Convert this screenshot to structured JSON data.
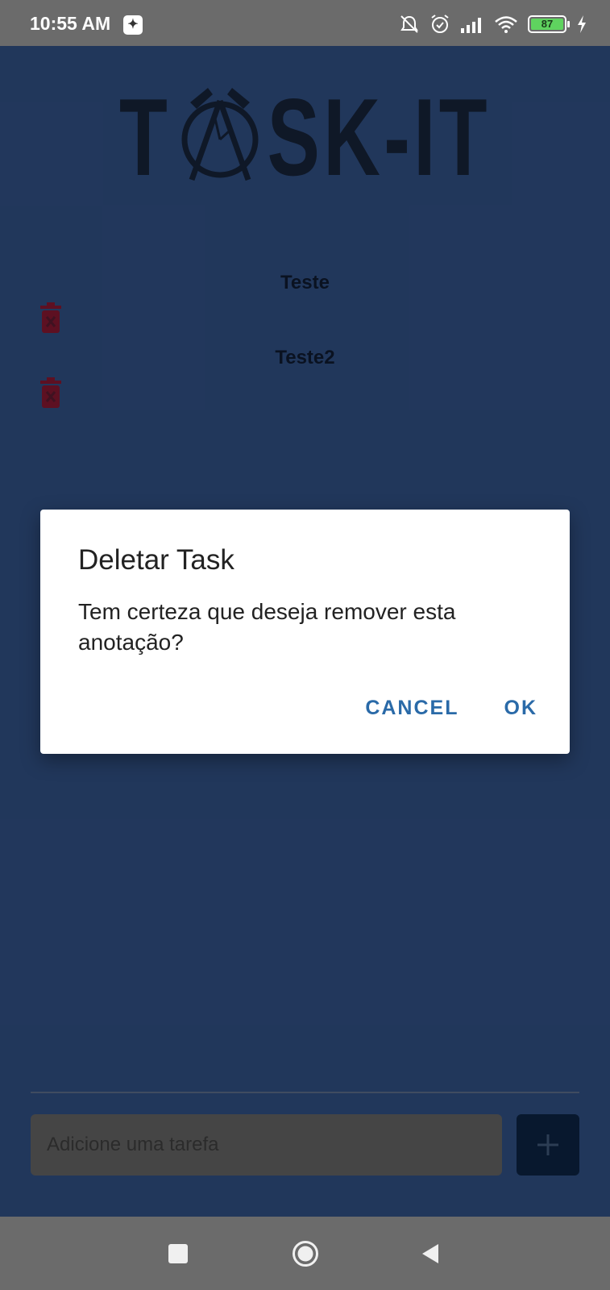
{
  "status_bar": {
    "time": "10:55 AM",
    "battery_level": "87",
    "icons": [
      "notification-app-icon",
      "mute-icon",
      "alarm-icon",
      "signal-icon",
      "wifi-icon",
      "battery-icon",
      "charging-icon"
    ]
  },
  "app": {
    "logo_text": {
      "left": "T",
      "right": "SK-IT"
    },
    "tasks": [
      {
        "title": "Teste"
      },
      {
        "title": "Teste2"
      }
    ],
    "input": {
      "placeholder": "Adicione uma tarefa",
      "value": ""
    },
    "add_button_icon": "plus-icon",
    "colors": {
      "background": "#3a5f9e",
      "trash": "#a11c3c",
      "accent": "#2a6aa8"
    }
  },
  "dialog": {
    "title": "Deletar Task",
    "message": "Tem certeza que deseja remover esta anotação?",
    "cancel_label": "CANCEL",
    "ok_label": "OK"
  },
  "nav_bar": {
    "icons": [
      "recents-icon",
      "home-icon",
      "back-icon"
    ]
  }
}
